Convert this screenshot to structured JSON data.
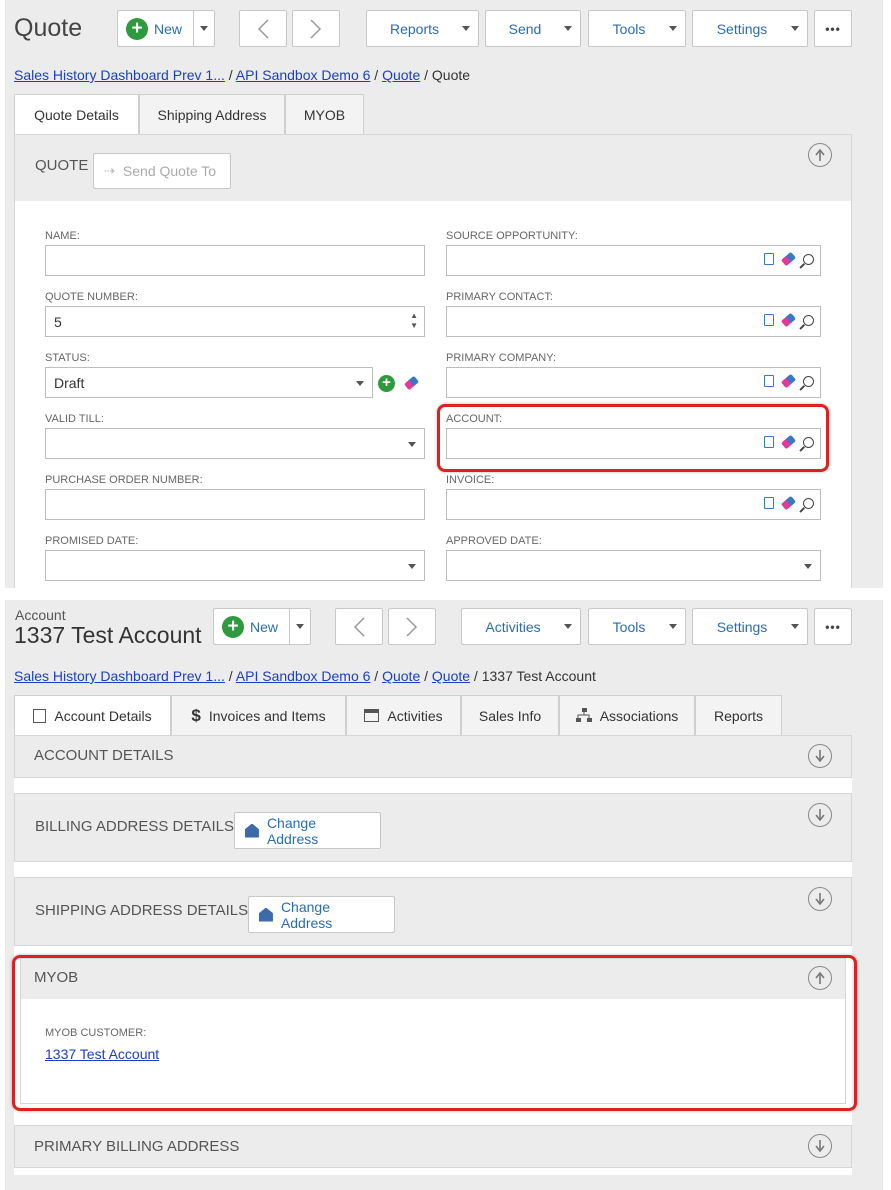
{
  "quote": {
    "title": "Quote",
    "toolbar": {
      "new_label": "New",
      "prev_icon": "chevron-left",
      "next_icon": "chevron-right",
      "reports_label": "Reports",
      "send_label": "Send",
      "tools_label": "Tools",
      "settings_label": "Settings",
      "more_label": "•••"
    },
    "breadcrumb": [
      {
        "label": "Sales History Dashboard Prev 1...",
        "link": true
      },
      {
        "label": "API Sandbox Demo 6",
        "link": true
      },
      {
        "label": "Quote",
        "link": true
      },
      {
        "label": "Quote",
        "link": false
      }
    ],
    "tabs": [
      "Quote Details",
      "Shipping Address",
      "MYOB"
    ],
    "section_title": "QUOTE",
    "send_quote_to": "Send Quote To",
    "fields": {
      "name_label": "NAME:",
      "name_value": "",
      "quote_number_label": "QUOTE NUMBER:",
      "quote_number_value": "5",
      "status_label": "STATUS:",
      "status_value": "Draft",
      "valid_till_label": "VALID TILL:",
      "valid_till_value": "",
      "po_number_label": "PURCHASE ORDER NUMBER:",
      "po_number_value": "",
      "promised_date_label": "PROMISED DATE:",
      "promised_date_value": "",
      "source_opp_label": "SOURCE OPPORTUNITY:",
      "primary_contact_label": "PRIMARY CONTACT:",
      "primary_company_label": "PRIMARY COMPANY:",
      "account_label": "ACCOUNT:",
      "invoice_label": "INVOICE:",
      "approved_date_label": "APPROVED DATE:"
    }
  },
  "account": {
    "subtitle": "Account",
    "title": "1337 Test Account",
    "toolbar": {
      "new_label": "New",
      "activities_label": "Activities",
      "tools_label": "Tools",
      "settings_label": "Settings",
      "more_label": "•••"
    },
    "breadcrumb": [
      {
        "label": "Sales History Dashboard Prev 1...",
        "link": true
      },
      {
        "label": "API Sandbox Demo 6",
        "link": true
      },
      {
        "label": "Quote",
        "link": true
      },
      {
        "label": "Quote",
        "link": true
      },
      {
        "label": "1337 Test Account",
        "link": false
      }
    ],
    "tabs": [
      {
        "label": "Account Details",
        "icon": "account-card-icon"
      },
      {
        "label": "Invoices and Items",
        "icon": "dollar-icon"
      },
      {
        "label": "Activities",
        "icon": "calendar-icon"
      },
      {
        "label": "Sales Info",
        "icon": ""
      },
      {
        "label": "Associations",
        "icon": "hierarchy-icon"
      },
      {
        "label": "Reports",
        "icon": ""
      }
    ],
    "sections": {
      "account_details": "ACCOUNT DETAILS",
      "billing_address": "BILLING ADDRESS DETAILS",
      "shipping_address": "SHIPPING ADDRESS DETAILS",
      "change_address": "Change Address",
      "myob": "MYOB",
      "myob_customer_label": "MYOB CUSTOMER:",
      "myob_customer_value": "1337 Test Account",
      "primary_billing": "PRIMARY BILLING ADDRESS"
    }
  },
  "colors": {
    "accent": "#2a6cb0",
    "link": "#1a3fc2",
    "highlight": "#e02020",
    "new_green": "#2e9a3e"
  }
}
